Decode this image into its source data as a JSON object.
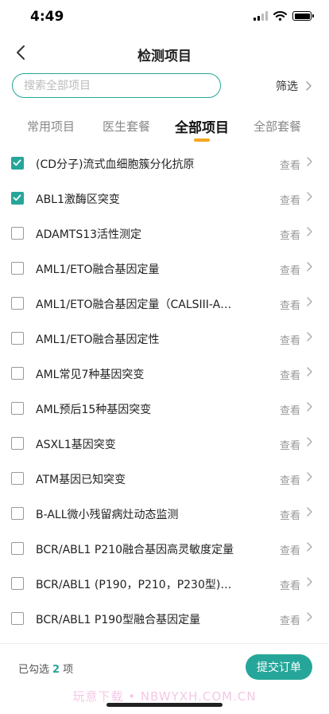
{
  "status": {
    "time": "4:49"
  },
  "nav": {
    "title": "检测项目"
  },
  "search": {
    "placeholder": "搜索全部项目",
    "filter_label": "筛选"
  },
  "tabs": [
    {
      "label": "常用项目",
      "active": false
    },
    {
      "label": "医生套餐",
      "active": false
    },
    {
      "label": "全部项目",
      "active": true
    },
    {
      "label": "全部套餐",
      "active": false
    }
  ],
  "items": [
    {
      "name": "(CD分子)流式血细胞簇分化抗原",
      "checked": true,
      "view": "查看"
    },
    {
      "name": "ABL1激酶区突变",
      "checked": true,
      "view": "查看"
    },
    {
      "name": "ADAMTS13活性测定",
      "checked": false,
      "view": "查看"
    },
    {
      "name": "AML1/ETO融合基因定量",
      "checked": false,
      "view": "查看"
    },
    {
      "name": "AML1/ETO融合基因定量（CALSIII-AM...",
      "checked": false,
      "view": "查看"
    },
    {
      "name": "AML1/ETO融合基因定性",
      "checked": false,
      "view": "查看"
    },
    {
      "name": "AML常见7种基因突变",
      "checked": false,
      "view": "查看"
    },
    {
      "name": "AML预后15种基因突变",
      "checked": false,
      "view": "查看"
    },
    {
      "name": "ASXL1基因突变",
      "checked": false,
      "view": "查看"
    },
    {
      "name": "ATM基因已知突变",
      "checked": false,
      "view": "查看"
    },
    {
      "name": "B-ALL微小残留病灶动态监测",
      "checked": false,
      "view": "查看"
    },
    {
      "name": "BCR/ABL1  P210融合基因高灵敏度定量",
      "checked": false,
      "view": "查看"
    },
    {
      "name": "BCR/ABL1 (P190，P210，P230型)融...",
      "checked": false,
      "view": "查看"
    },
    {
      "name": "BCR/ABL1 P190型融合基因定量",
      "checked": false,
      "view": "查看"
    }
  ],
  "footer": {
    "selected_prefix": "已勾选",
    "selected_count": "2",
    "selected_suffix": "项",
    "submit_label": "提交订单",
    "watermark": "玩意下载 • NBWYXH.COM.CN"
  },
  "colors": {
    "accent": "#26a69a",
    "tab_indicator": "#f5a623"
  },
  "icons": [
    "back-chevron-icon",
    "chevron-right-icon",
    "check-icon",
    "signal-icon",
    "wifi-icon",
    "battery-icon"
  ]
}
